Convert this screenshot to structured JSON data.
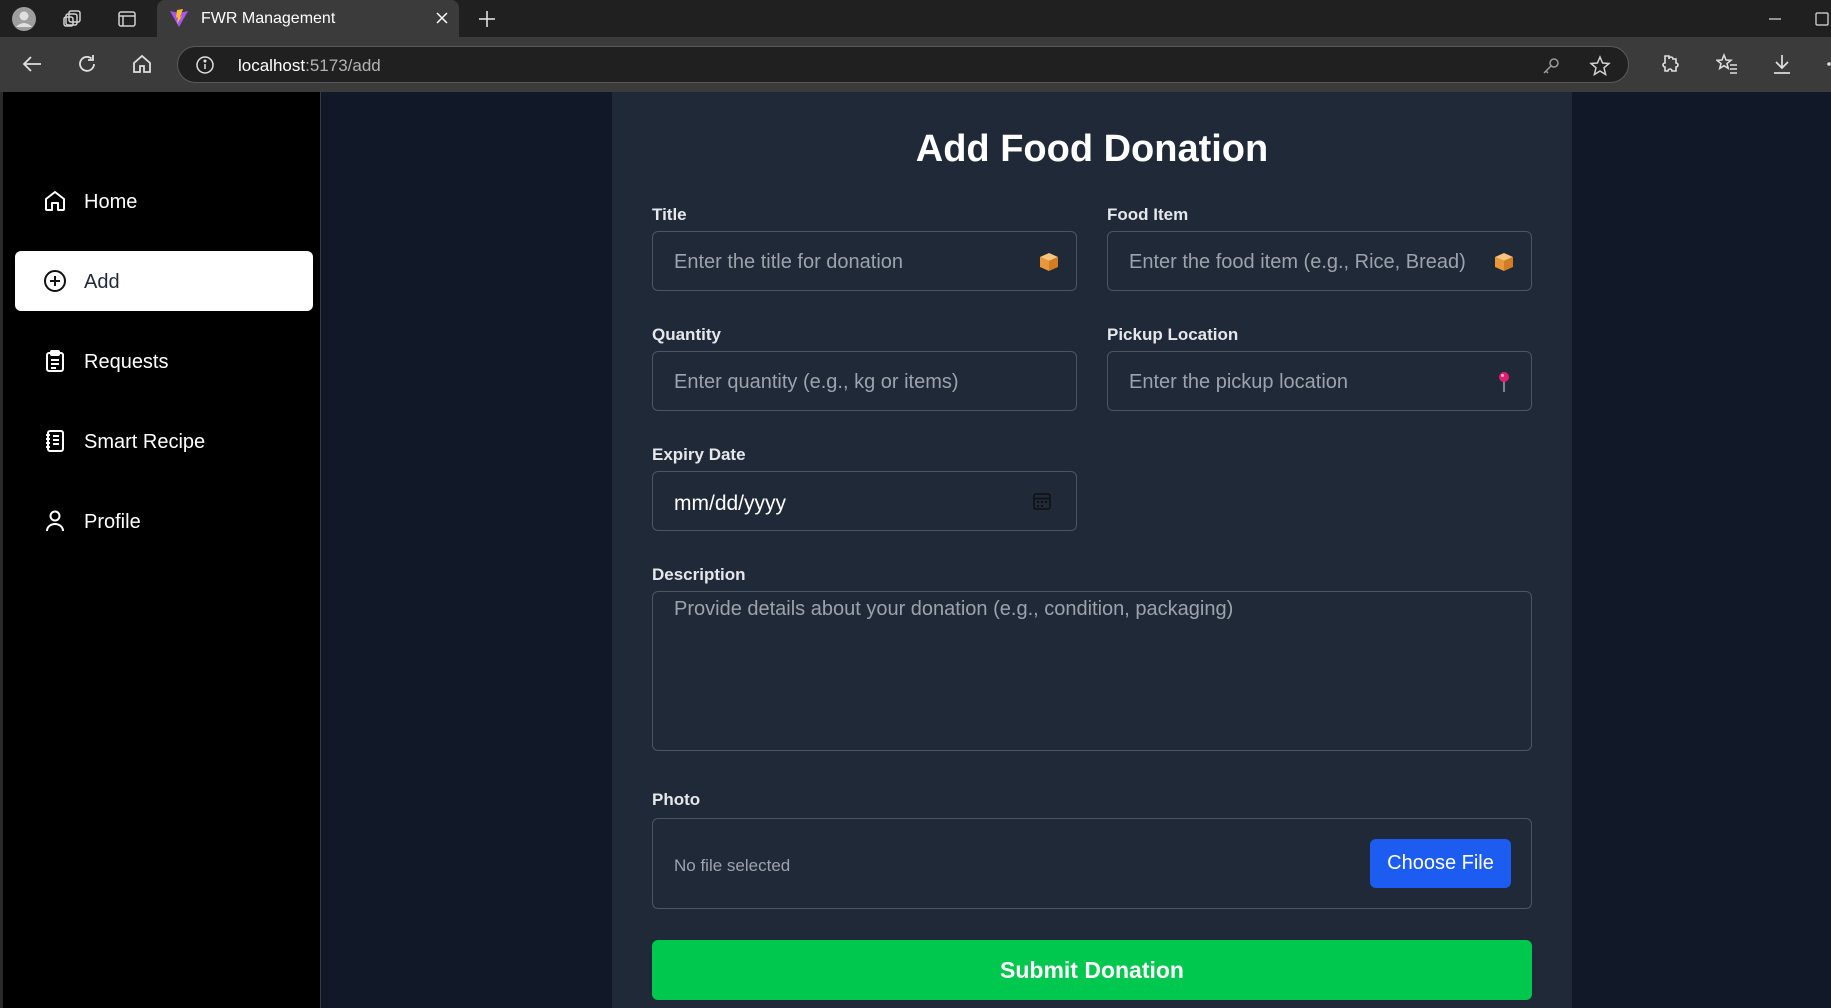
{
  "browser": {
    "tab_title": "FWR Management",
    "url_host": "localhost",
    "url_path": ":5173/add"
  },
  "sidebar": {
    "items": [
      {
        "label": "Home",
        "icon": "home-icon"
      },
      {
        "label": "Add",
        "icon": "plus-circle-icon",
        "active": true
      },
      {
        "label": "Requests",
        "icon": "clipboard-icon"
      },
      {
        "label": "Smart Recipe",
        "icon": "recipe-book-icon"
      },
      {
        "label": "Profile",
        "icon": "user-icon"
      }
    ]
  },
  "form": {
    "title": "Add Food Donation",
    "fields": {
      "title": {
        "label": "Title",
        "placeholder": "Enter the title for donation",
        "icon": "box-icon"
      },
      "food_item": {
        "label": "Food Item",
        "placeholder": "Enter the food item (e.g., Rice, Bread)",
        "icon": "box-icon"
      },
      "quantity": {
        "label": "Quantity",
        "placeholder": "Enter quantity (e.g., kg or items)"
      },
      "pickup_location": {
        "label": "Pickup Location",
        "placeholder": "Enter the pickup location",
        "icon": "pin-icon"
      },
      "expiry_date": {
        "label": "Expiry Date",
        "value": "mm/dd/yyyy",
        "icon": "calendar-icon"
      },
      "description": {
        "label": "Description",
        "placeholder": "Provide details about your donation (e.g., condition, packaging)"
      },
      "photo": {
        "label": "Photo",
        "status": "No file selected",
        "button": "Choose File"
      }
    },
    "submit_label": "Submit Donation"
  },
  "colors": {
    "page_bg": "#111827",
    "card_bg": "#1f2937",
    "sidebar_bg": "#000000",
    "primary_button": "#1d5cf0",
    "submit_button": "#00c74e"
  }
}
